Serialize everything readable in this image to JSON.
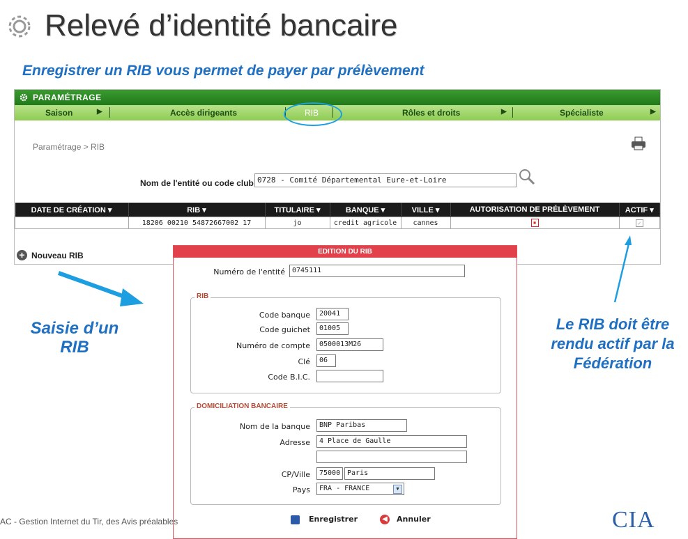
{
  "slide": {
    "title": "Relevé d’identité bancaire",
    "subtitle": "Enregistrer un RIB vous permet de payer par prélèvement",
    "note_left": "Saisie d’un RIB",
    "note_right": "Le RIB doit être rendu actif par la Fédération",
    "footer": "AC - Gestion Internet du Tir, des Avis préalables",
    "logo": "CIA",
    "accent_color": "#1f6fc2"
  },
  "app": {
    "header_title": "PARAMÉTRAGE",
    "menu": [
      {
        "label": "Saison"
      },
      {
        "label": "Accès dirigeants"
      },
      {
        "label": "RIB"
      },
      {
        "label": "Rôles et droits"
      },
      {
        "label": "Spécialiste"
      }
    ],
    "breadcrumb": "Paramétrage > RIB",
    "entity": {
      "label": "Nom de l'entité ou code club",
      "value": "0728 - Comité Départemental Eure-et-Loire"
    },
    "table": {
      "headers": [
        "DATE DE CRÉATION ▾",
        "RIB ▾",
        "TITULAIRE ▾",
        "BANQUE ▾",
        "VILLE ▾",
        "AUTORISATION DE PRÉLÈVEMENT",
        "ACTIF ▾"
      ],
      "rows": [
        {
          "date": "",
          "rib": "18206 00210 54872667002 17",
          "titulaire": "jo",
          "banque": "credit agricole",
          "ville": "cannes"
        }
      ]
    },
    "new_rib_label": "Nouveau RIB"
  },
  "modal": {
    "title": "EDITION DU RIB",
    "entity_number_label": "Numéro de l'entité",
    "entity_number_value": "0745111",
    "rib_legend": "RIB",
    "code_banque_label": "Code banque",
    "code_banque_value": "20041",
    "code_guichet_label": "Code guichet",
    "code_guichet_value": "01005",
    "numero_compte_label": "Numéro de compte",
    "numero_compte_value": "0500013M26",
    "cle_label": "Clé",
    "cle_value": "06",
    "bic_label": "Code B.I.C.",
    "bic_value": "",
    "domiciliation_legend": "DOMICILIATION BANCAIRE",
    "nom_banque_label": "Nom de la banque",
    "nom_banque_value": "BNP Paribas",
    "adresse_label": "Adresse",
    "adresse_value": "4 Place de Gaulle",
    "adresse2_value": "",
    "cp_ville_label": "CP/Ville",
    "cp_value": "75000",
    "ville_value": "Paris",
    "pays_label": "Pays",
    "pays_value": "FRA - FRANCE",
    "save_label": "Enregistrer",
    "cancel_label": "Annuler"
  }
}
